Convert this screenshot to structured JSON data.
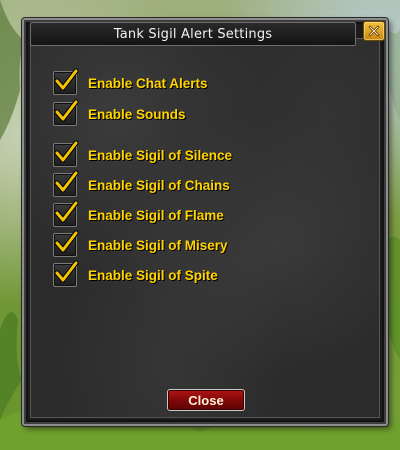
{
  "window": {
    "title": "Tank Sigil Alert Settings",
    "close_icon": "close-x-icon"
  },
  "options": [
    {
      "label": "Enable Chat Alerts",
      "checked": true
    },
    {
      "label": "Enable Sounds",
      "checked": true
    },
    {
      "label": "Enable Sigil of Silence",
      "checked": true
    },
    {
      "label": "Enable Sigil of Chains",
      "checked": true
    },
    {
      "label": "Enable Sigil of Flame",
      "checked": true
    },
    {
      "label": "Enable Sigil of Misery",
      "checked": true
    },
    {
      "label": "Enable Sigil of Spite",
      "checked": true
    }
  ],
  "footer": {
    "close_label": "Close"
  },
  "colors": {
    "label": "#ffd400",
    "checkmark": "#f5c400",
    "close_button": "#8a0808",
    "close_x": "#e0a020"
  }
}
